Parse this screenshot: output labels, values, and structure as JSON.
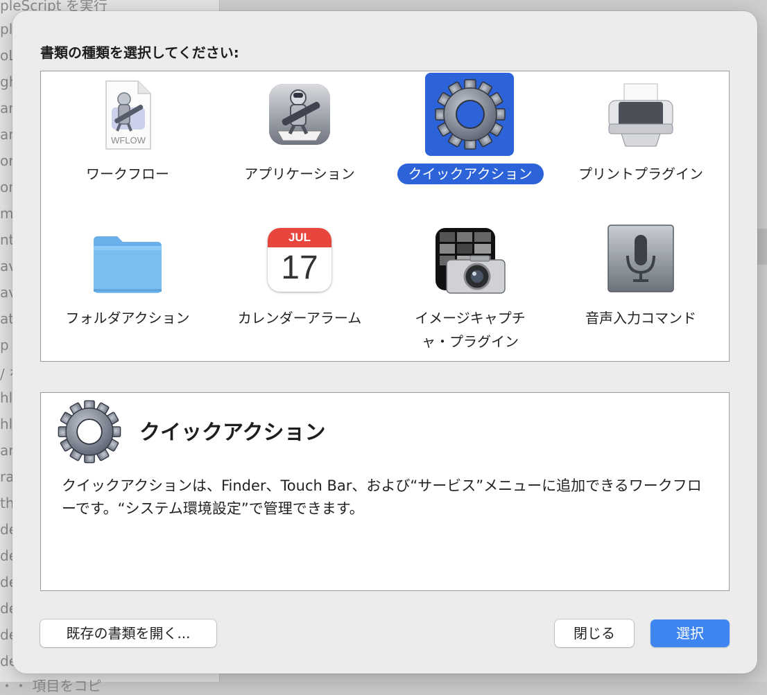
{
  "background": {
    "fragments": [
      "pleScript を実行",
      "ple",
      "oL",
      "gh",
      "an",
      "an",
      "or",
      "on",
      "mp",
      "ntr",
      "av",
      "av",
      "at",
      "p",
      "/ を",
      "hl",
      "hl",
      "ar",
      "rac",
      "th",
      "de",
      "de",
      "de",
      "de",
      "de",
      "de",
      "・・ 項目をコピ"
    ]
  },
  "dialog": {
    "prompt": "書類の種類を選択してください:",
    "items": [
      {
        "label": "ワークフロー",
        "icon": "workflow-document-icon",
        "badge": "WFLOW"
      },
      {
        "label": "アプリケーション",
        "icon": "automator-app-icon"
      },
      {
        "label": "クイックアクション",
        "icon": "gear-icon",
        "selected": true
      },
      {
        "label": "プリントプラグイン",
        "icon": "printer-icon"
      },
      {
        "label": "フォルダアクション",
        "icon": "folder-icon"
      },
      {
        "label": "カレンダーアラーム",
        "icon": "calendar-icon",
        "calendar_month": "JUL",
        "calendar_day": "17"
      },
      {
        "label": "イメージキャプチャ・プラグイン",
        "label_line1": "イメージキャプチ",
        "label_line2": "ャ・プラグイン",
        "icon": "image-capture-icon"
      },
      {
        "label": "音声入力コマンド",
        "icon": "microphone-icon"
      }
    ],
    "description": {
      "title": "クイックアクション",
      "body": "クイックアクションは、Finder、Touch Bar、および“サービス”メニューに追加できるワークフローです。“システム環境設定”で管理できます。"
    },
    "buttons": {
      "open_existing": "既存の書類を開く...",
      "close": "閉じる",
      "choose": "選択"
    }
  },
  "colors": {
    "accent": "#2c63d8",
    "primary_button": "#3e85f1"
  }
}
